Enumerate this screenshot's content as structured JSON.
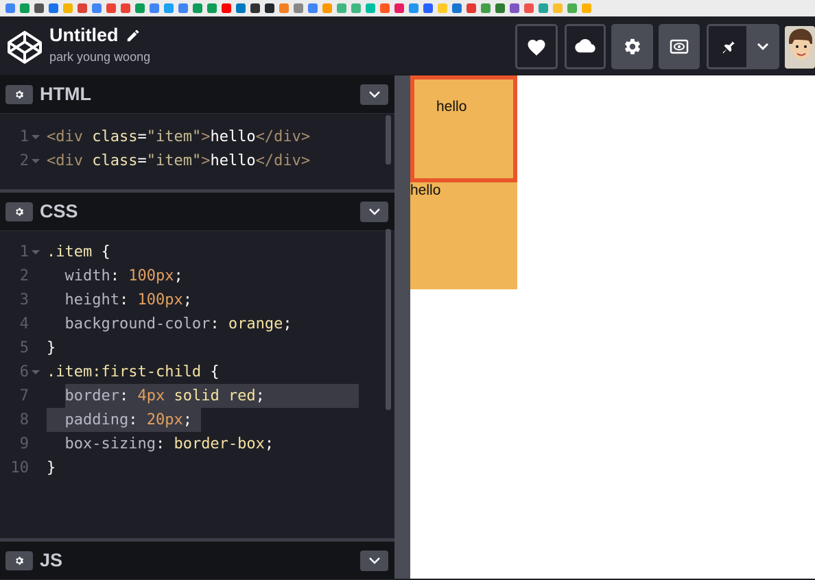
{
  "project": {
    "title": "Untitled",
    "author": "park young woong"
  },
  "header_buttons": [
    {
      "name": "love",
      "icon": "heart-icon"
    },
    {
      "name": "save",
      "icon": "cloud-icon"
    },
    {
      "name": "settings",
      "icon": "gear-icon"
    },
    {
      "name": "view",
      "icon": "eye-icon"
    },
    {
      "name": "pin",
      "icon": "pin-icon"
    },
    {
      "name": "more",
      "icon": "chevron-down-icon"
    }
  ],
  "panes": {
    "html": {
      "label": "HTML"
    },
    "css": {
      "label": "CSS"
    },
    "js": {
      "label": "JS"
    }
  },
  "html_code": [
    {
      "num": "1",
      "parts": [
        [
          "c-tag",
          "<div "
        ],
        [
          "c-attr",
          "class"
        ],
        [
          "c-punc",
          "="
        ],
        [
          "c-str",
          "\"item\""
        ],
        [
          "c-tag",
          ">"
        ],
        [
          "c-plain",
          "hello"
        ],
        [
          "c-tag",
          "</div>"
        ]
      ]
    },
    {
      "num": "2",
      "parts": [
        [
          "c-tag",
          "<div "
        ],
        [
          "c-attr",
          "class"
        ],
        [
          "c-punc",
          "="
        ],
        [
          "c-str",
          "\"item\""
        ],
        [
          "c-tag",
          ">"
        ],
        [
          "c-plain",
          "hello"
        ],
        [
          "c-tag",
          "</div>"
        ]
      ]
    }
  ],
  "css_code": [
    {
      "num": "1",
      "parts": [
        [
          "c-sel",
          ".item"
        ],
        [
          "c-punc",
          " {"
        ]
      ]
    },
    {
      "num": "2",
      "parts": [
        [
          "c-prop",
          "  width"
        ],
        [
          "c-punc",
          ": "
        ],
        [
          "c-num",
          "100px"
        ],
        [
          "c-punc",
          ";"
        ]
      ]
    },
    {
      "num": "3",
      "parts": [
        [
          "c-prop",
          "  height"
        ],
        [
          "c-punc",
          ": "
        ],
        [
          "c-num",
          "100px"
        ],
        [
          "c-punc",
          ";"
        ]
      ]
    },
    {
      "num": "4",
      "parts": [
        [
          "c-prop",
          "  background-color"
        ],
        [
          "c-punc",
          ": "
        ],
        [
          "c-val",
          "orange"
        ],
        [
          "c-punc",
          ";"
        ]
      ]
    },
    {
      "num": "5",
      "parts": [
        [
          "c-punc",
          "}"
        ]
      ]
    },
    {
      "num": "6",
      "parts": [
        [
          "c-sel",
          ".item"
        ],
        [
          "c-val",
          ":first-child"
        ],
        [
          "c-punc",
          " {"
        ]
      ]
    },
    {
      "num": "7",
      "parts": [
        [
          "c-prop",
          "  border"
        ],
        [
          "c-punc",
          ": "
        ],
        [
          "c-num",
          "4px"
        ],
        [
          "c-val",
          " solid red"
        ],
        [
          "c-punc",
          ";"
        ]
      ]
    },
    {
      "num": "8",
      "parts": [
        [
          "c-prop",
          "  padding"
        ],
        [
          "c-punc",
          ": "
        ],
        [
          "c-num",
          "20px"
        ],
        [
          "c-punc",
          ";"
        ]
      ]
    },
    {
      "num": "9",
      "parts": [
        [
          "c-prop",
          "  box-sizing"
        ],
        [
          "c-punc",
          ": "
        ],
        [
          "c-val",
          "border-box"
        ],
        [
          "c-punc",
          ";"
        ]
      ]
    },
    {
      "num": "10",
      "parts": [
        [
          "c-punc",
          "}"
        ]
      ]
    }
  ],
  "preview": {
    "item1_text": "hello",
    "item2_text": "hello"
  },
  "colors": {
    "orange_box": "#f0b556",
    "red_border": "#e9562c"
  }
}
